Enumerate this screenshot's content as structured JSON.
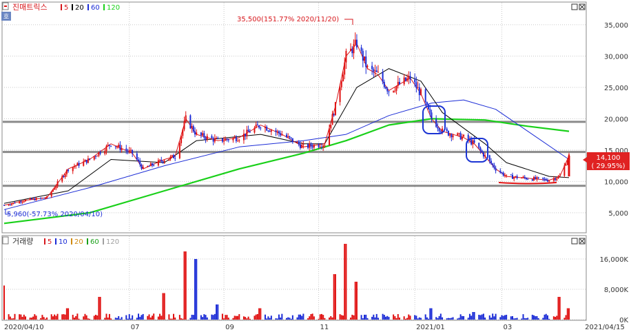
{
  "price_panel": {
    "title": "진매트릭스",
    "ma_legend": [
      {
        "label": "5",
        "color": "#d7161b"
      },
      {
        "label": "20",
        "color": "#000000"
      },
      {
        "label": "60",
        "color": "#1a2bd6"
      },
      {
        "label": "120",
        "color": "#19d019"
      }
    ],
    "high_annotation": "35,500(151.77% 2020/11/20)",
    "low_annotation": "5,960(-57.73% 2020/04/10)",
    "last_price_label": "14,100",
    "last_change_label": "( 29.95%)",
    "zoom_icon_label": "호"
  },
  "volume_panel": {
    "title": "거래량",
    "ma_legend": [
      {
        "label": "5",
        "color": "#d7161b"
      },
      {
        "label": "10",
        "color": "#1a2bd6"
      },
      {
        "label": "20",
        "color": "#d08a0f"
      },
      {
        "label": "60",
        "color": "#19a019"
      },
      {
        "label": "120",
        "color": "#a0a0a0"
      }
    ]
  },
  "x_axis": {
    "start_label": "2020/04/10",
    "end_label": "2021/04/15",
    "ticks": [
      "07",
      "09",
      "11",
      "2021/01",
      "03"
    ]
  },
  "chart_data": [
    {
      "type": "candlestick",
      "title": "진매트릭스",
      "y_ticks": [
        5000,
        10000,
        15000,
        20000,
        25000,
        30000,
        35000
      ],
      "y_tick_labels": [
        "5,000",
        "10,000",
        "15,000",
        "20,000",
        "25,000",
        "30,000",
        "35,000"
      ],
      "ylim": [
        1800,
        38500
      ],
      "horizontal_levels": [
        19500,
        14700,
        9300
      ],
      "last_price": 14100,
      "last_change_pct": 29.95,
      "close_points": [
        {
          "date": "2020-04-10",
          "close": 6200
        },
        {
          "date": "2020-04-24",
          "close": 7000
        },
        {
          "date": "2020-05-08",
          "close": 7400
        },
        {
          "date": "2020-05-22",
          "close": 12000
        },
        {
          "date": "2020-06-05",
          "close": 13500
        },
        {
          "date": "2020-06-19",
          "close": 16000
        },
        {
          "date": "2020-07-03",
          "close": 14500
        },
        {
          "date": "2020-07-10",
          "close": 12000
        },
        {
          "date": "2020-07-24",
          "close": 13500
        },
        {
          "date": "2020-07-31",
          "close": 14000
        },
        {
          "date": "2020-08-07",
          "close": 20000
        },
        {
          "date": "2020-08-14",
          "close": 17500
        },
        {
          "date": "2020-08-28",
          "close": 16500
        },
        {
          "date": "2020-09-11",
          "close": 17000
        },
        {
          "date": "2020-09-25",
          "close": 19000
        },
        {
          "date": "2020-10-09",
          "close": 17500
        },
        {
          "date": "2020-10-23",
          "close": 15500
        },
        {
          "date": "2020-11-06",
          "close": 16000
        },
        {
          "date": "2020-11-13",
          "close": 22000
        },
        {
          "date": "2020-11-20",
          "close": 30000
        },
        {
          "date": "2020-11-27",
          "close": 32000
        },
        {
          "date": "2020-12-04",
          "close": 28000
        },
        {
          "date": "2020-12-11",
          "close": 27000
        },
        {
          "date": "2020-12-18",
          "close": 24500
        },
        {
          "date": "2020-12-25",
          "close": 25500
        },
        {
          "date": "2021-01-01",
          "close": 26500
        },
        {
          "date": "2021-01-08",
          "close": 24000
        },
        {
          "date": "2021-01-15",
          "close": 20000
        },
        {
          "date": "2021-01-22",
          "close": 18000
        },
        {
          "date": "2021-02-05",
          "close": 17000
        },
        {
          "date": "2021-02-12",
          "close": 16000
        },
        {
          "date": "2021-02-19",
          "close": 14000
        },
        {
          "date": "2021-02-26",
          "close": 12000
        },
        {
          "date": "2021-03-05",
          "close": 10800
        },
        {
          "date": "2021-03-19",
          "close": 10500
        },
        {
          "date": "2021-04-02",
          "close": 10200
        },
        {
          "date": "2021-04-09",
          "close": 10800
        },
        {
          "date": "2021-04-15",
          "close": 14100
        }
      ],
      "ma20_points": [
        {
          "date": "2020-04-10",
          "value": 6500
        },
        {
          "date": "2020-05-22",
          "value": 8500
        },
        {
          "date": "2020-06-19",
          "value": 13500
        },
        {
          "date": "2020-07-24",
          "value": 13000
        },
        {
          "date": "2020-08-14",
          "value": 16500
        },
        {
          "date": "2020-09-25",
          "value": 17500
        },
        {
          "date": "2020-10-23",
          "value": 16000
        },
        {
          "date": "2020-11-06",
          "value": 16000
        },
        {
          "date": "2020-11-27",
          "value": 25000
        },
        {
          "date": "2020-12-18",
          "value": 28000
        },
        {
          "date": "2021-01-08",
          "value": 26000
        },
        {
          "date": "2021-01-22",
          "value": 21000
        },
        {
          "date": "2021-02-19",
          "value": 16000
        },
        {
          "date": "2021-03-05",
          "value": 13000
        },
        {
          "date": "2021-04-02",
          "value": 10800
        },
        {
          "date": "2021-04-15",
          "value": 10600
        }
      ],
      "ma60_points": [
        {
          "date": "2020-04-10",
          "value": 5500
        },
        {
          "date": "2020-06-05",
          "value": 9000
        },
        {
          "date": "2020-07-24",
          "value": 12500
        },
        {
          "date": "2020-09-11",
          "value": 15500
        },
        {
          "date": "2020-10-23",
          "value": 16500
        },
        {
          "date": "2020-11-20",
          "value": 17500
        },
        {
          "date": "2020-12-18",
          "value": 20500
        },
        {
          "date": "2021-01-15",
          "value": 22500
        },
        {
          "date": "2021-02-05",
          "value": 23000
        },
        {
          "date": "2021-02-26",
          "value": 21500
        },
        {
          "date": "2021-03-19",
          "value": 18000
        },
        {
          "date": "2021-04-15",
          "value": 13500
        }
      ],
      "ma120_points": [
        {
          "date": "2020-04-10",
          "value": 3300
        },
        {
          "date": "2020-06-05",
          "value": 5000
        },
        {
          "date": "2020-07-24",
          "value": 8500
        },
        {
          "date": "2020-09-11",
          "value": 12000
        },
        {
          "date": "2020-10-23",
          "value": 14500
        },
        {
          "date": "2020-11-20",
          "value": 16500
        },
        {
          "date": "2020-12-18",
          "value": 19000
        },
        {
          "date": "2021-01-15",
          "value": 20000
        },
        {
          "date": "2021-02-19",
          "value": 19800
        },
        {
          "date": "2021-03-19",
          "value": 18800
        },
        {
          "date": "2021-04-15",
          "value": 18000
        }
      ]
    },
    {
      "type": "bar",
      "title": "거래량",
      "y_ticks": [
        0,
        8000,
        16000
      ],
      "y_tick_labels": [
        "0K",
        "8,000K",
        "16,000K"
      ],
      "ylim": [
        0,
        22000
      ],
      "volume_points": [
        {
          "date": "2020-04-10",
          "value": 9000
        },
        {
          "date": "2020-05-22",
          "value": 3000
        },
        {
          "date": "2020-06-12",
          "value": 6000
        },
        {
          "date": "2020-07-24",
          "value": 7000
        },
        {
          "date": "2020-08-07",
          "value": 18000
        },
        {
          "date": "2020-08-14",
          "value": 16000
        },
        {
          "date": "2020-08-28",
          "value": 4000
        },
        {
          "date": "2020-09-25",
          "value": 3000
        },
        {
          "date": "2020-11-13",
          "value": 12000
        },
        {
          "date": "2020-11-20",
          "value": 20000
        },
        {
          "date": "2020-11-27",
          "value": 10000
        },
        {
          "date": "2021-01-15",
          "value": 3000
        },
        {
          "date": "2021-02-12",
          "value": 2000
        },
        {
          "date": "2021-04-09",
          "value": 6000
        },
        {
          "date": "2021-04-15",
          "value": 3000
        }
      ]
    }
  ]
}
